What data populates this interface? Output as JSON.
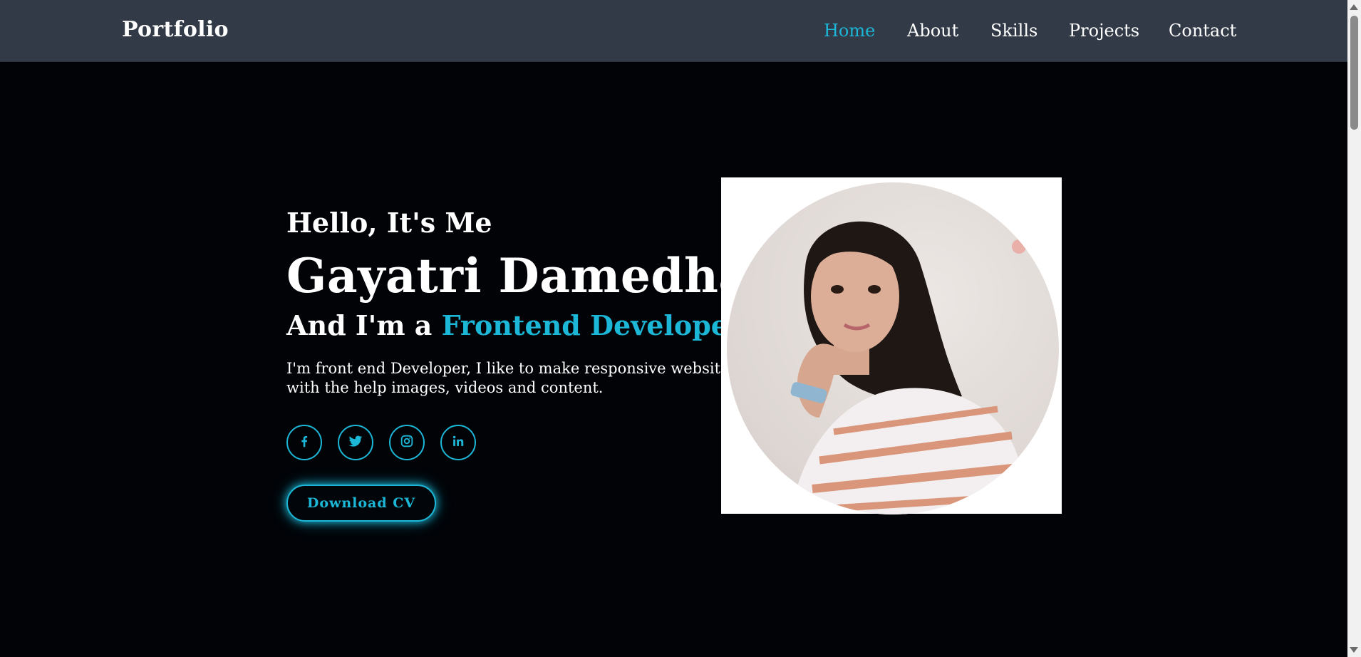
{
  "header": {
    "brand": "Portfolio",
    "nav": [
      {
        "label": "Home",
        "active": true
      },
      {
        "label": "About",
        "active": false
      },
      {
        "label": "Skills",
        "active": false
      },
      {
        "label": "Projects",
        "active": false
      },
      {
        "label": "Contact",
        "active": false
      }
    ]
  },
  "hero": {
    "greeting": "Hello, It's Me",
    "name": "Gayatri Damedhar",
    "role_prefix": "And I'm a ",
    "role_highlight": "Frontend Developer|",
    "bio": "I'm front end Developer, I like to make responsive websites with the help images, videos and content.",
    "socials": [
      {
        "icon": "facebook-icon"
      },
      {
        "icon": "twitter-icon"
      },
      {
        "icon": "instagram-icon"
      },
      {
        "icon": "linkedin-icon"
      }
    ],
    "cv_button": "Download CV"
  },
  "colors": {
    "accent": "#1cb7d6",
    "navbar": "#323a47",
    "background": "#010307"
  }
}
